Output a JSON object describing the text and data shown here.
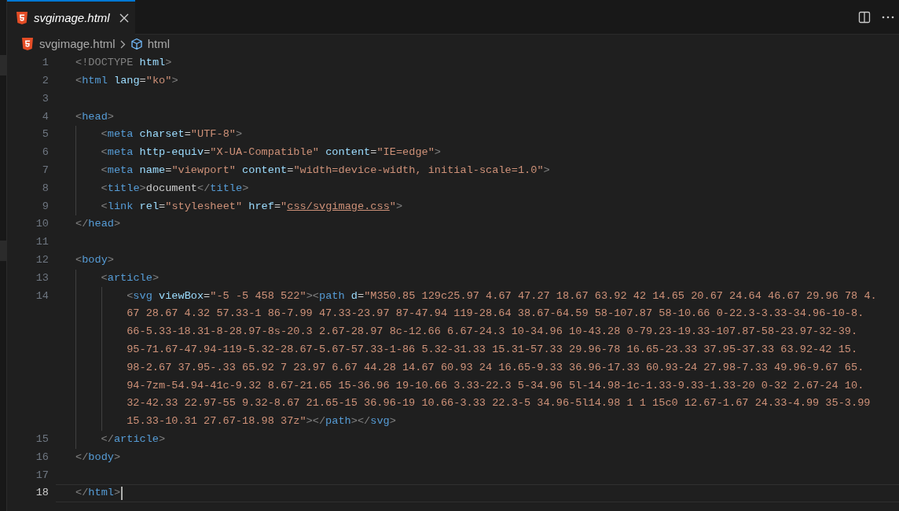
{
  "tab": {
    "title": "svgimage.html",
    "selected": true
  },
  "breadcrumb": {
    "file": "svgimage.html",
    "symbol": "html"
  },
  "lines": [
    {
      "number": "1",
      "current": false,
      "tokens": [
        {
          "kind": "punct",
          "text": "<!DOCTYPE"
        },
        {
          "kind": "attr",
          "text": " html"
        },
        {
          "kind": "punct",
          "text": ">"
        }
      ]
    },
    {
      "number": "2",
      "current": false,
      "tokens": [
        {
          "kind": "punct",
          "text": "<"
        },
        {
          "kind": "tag",
          "text": "html"
        },
        {
          "kind": "attr",
          "text": " lang"
        },
        {
          "kind": "plain",
          "text": "="
        },
        {
          "kind": "str",
          "text": "\"ko\""
        },
        {
          "kind": "punct",
          "text": ">"
        }
      ]
    },
    {
      "number": "3",
      "current": false
    },
    {
      "number": "4",
      "current": false,
      "tokens": [
        {
          "kind": "punct",
          "text": "<"
        },
        {
          "kind": "tag",
          "text": "head"
        },
        {
          "kind": "punct",
          "text": ">"
        }
      ],
      "children": [
        {
          "number": "5",
          "current": false,
          "tokens": [
            {
              "kind": "punct",
              "text": "<"
            },
            {
              "kind": "tag",
              "text": "meta"
            },
            {
              "kind": "attr",
              "text": " charset"
            },
            {
              "kind": "plain",
              "text": "="
            },
            {
              "kind": "str",
              "text": "\"UTF-8\""
            },
            {
              "kind": "punct",
              "text": ">"
            }
          ]
        },
        {
          "number": "6",
          "current": false,
          "tokens": [
            {
              "kind": "punct",
              "text": "<"
            },
            {
              "kind": "tag",
              "text": "meta"
            },
            {
              "kind": "attr",
              "text": " http-equiv"
            },
            {
              "kind": "plain",
              "text": "="
            },
            {
              "kind": "str",
              "text": "\"X-UA-Compatible\""
            },
            {
              "kind": "attr",
              "text": " content"
            },
            {
              "kind": "plain",
              "text": "="
            },
            {
              "kind": "str",
              "text": "\"IE=edge\""
            },
            {
              "kind": "punct",
              "text": ">"
            }
          ]
        },
        {
          "number": "7",
          "current": false,
          "tokens": [
            {
              "kind": "punct",
              "text": "<"
            },
            {
              "kind": "tag",
              "text": "meta"
            },
            {
              "kind": "attr",
              "text": " name"
            },
            {
              "kind": "plain",
              "text": "="
            },
            {
              "kind": "str",
              "text": "\"viewport\""
            },
            {
              "kind": "attr",
              "text": " content"
            },
            {
              "kind": "plain",
              "text": "="
            },
            {
              "kind": "str",
              "text": "\"width=device-width, initial-scale=1.0\""
            },
            {
              "kind": "punct",
              "text": ">"
            }
          ]
        },
        {
          "number": "8",
          "current": false,
          "tokens": [
            {
              "kind": "punct",
              "text": "<"
            },
            {
              "kind": "tag",
              "text": "title"
            },
            {
              "kind": "punct",
              "text": ">"
            },
            {
              "kind": "plain",
              "text": "document"
            },
            {
              "kind": "punct",
              "text": "</"
            },
            {
              "kind": "tag",
              "text": "title"
            },
            {
              "kind": "punct",
              "text": ">"
            }
          ]
        },
        {
          "number": "9",
          "current": false,
          "tokens": [
            {
              "kind": "punct",
              "text": "<"
            },
            {
              "kind": "tag",
              "text": "link"
            },
            {
              "kind": "attr",
              "text": " rel"
            },
            {
              "kind": "plain",
              "text": "="
            },
            {
              "kind": "str",
              "text": "\"stylesheet\""
            },
            {
              "kind": "attr",
              "text": " href"
            },
            {
              "kind": "plain",
              "text": "="
            },
            {
              "kind": "str",
              "text": "\""
            },
            {
              "kind": "link",
              "text": "css/svgimage.css"
            },
            {
              "kind": "str",
              "text": "\""
            },
            {
              "kind": "punct",
              "text": ">"
            }
          ]
        }
      ]
    },
    {
      "number": "10",
      "current": false,
      "tokens": [
        {
          "kind": "punct",
          "text": "</"
        },
        {
          "kind": "tag",
          "text": "head"
        },
        {
          "kind": "punct",
          "text": ">"
        }
      ]
    },
    {
      "number": "11",
      "current": false
    },
    {
      "number": "12",
      "current": false,
      "tokens": [
        {
          "kind": "punct",
          "text": "<"
        },
        {
          "kind": "tag",
          "text": "body"
        },
        {
          "kind": "punct",
          "text": ">"
        }
      ],
      "children": [
        {
          "number": "13",
          "current": false,
          "tokens": [
            {
              "kind": "punct",
              "text": "<"
            },
            {
              "kind": "tag",
              "text": "article"
            },
            {
              "kind": "punct",
              "text": ">"
            }
          ],
          "children": [
            {
              "number": "14",
              "current": false,
              "tokens": [
                {
                  "kind": "punct",
                  "text": "<"
                },
                {
                  "kind": "tag",
                  "text": "svg"
                },
                {
                  "kind": "attr",
                  "text": " viewBox"
                },
                {
                  "kind": "plain",
                  "text": "="
                },
                {
                  "kind": "str",
                  "text": "\"-5 -5 458 522\""
                },
                {
                  "kind": "punct",
                  "text": "><"
                },
                {
                  "kind": "tag",
                  "text": "path"
                },
                {
                  "kind": "attr",
                  "text": " d"
                },
                {
                  "kind": "plain",
                  "text": "="
                },
                {
                  "kind": "str",
                  "text": "\"M350.85 129c25.97 4.67 47.27 18.67 63.92 42 14.65 20.67 24.64 46.67 29.96 78 4."
                }
              ],
              "continuations": [
                {
                  "tokens": [
                    {
                      "kind": "str",
                      "text": "67 28.67 4.32 57.33-1 86-7.99 47.33-23.97 87-47.94 119-28.64 38.67-64.59 58-107.87 58-10.66 0-22.3-3.33-34.96-10-8."
                    }
                  ]
                },
                {
                  "tokens": [
                    {
                      "kind": "str",
                      "text": "66-5.33-18.31-8-28.97-8s-20.3 2.67-28.97 8c-12.66 6.67-24.3 10-34.96 10-43.28 0-79.23-19.33-107.87-58-23.97-32-39."
                    }
                  ]
                },
                {
                  "tokens": [
                    {
                      "kind": "str",
                      "text": "95-71.67-47.94-119-5.32-28.67-5.67-57.33-1-86 5.32-31.33 15.31-57.33 29.96-78 16.65-23.33 37.95-37.33 63.92-42 15."
                    }
                  ]
                },
                {
                  "tokens": [
                    {
                      "kind": "str",
                      "text": "98-2.67 37.95-.33 65.92 7 23.97 6.67 44.28 14.67 60.93 24 16.65-9.33 36.96-17.33 60.93-24 27.98-7.33 49.96-9.67 65."
                    }
                  ]
                },
                {
                  "tokens": [
                    {
                      "kind": "str",
                      "text": "94-7zm-54.94-41c-9.32 8.67-21.65 15-36.96 19-10.66 3.33-22.3 5-34.96 5l-14.98-1c-1.33-9.33-1.33-20 0-32 2.67-24 10."
                    }
                  ]
                },
                {
                  "tokens": [
                    {
                      "kind": "str",
                      "text": "32-42.33 22.97-55 9.32-8.67 21.65-15 36.96-19 10.66-3.33 22.3-5 34.96-5l14.98 1 1 15c0 12.67-1.67 24.33-4.99 35-3.99"
                    }
                  ]
                },
                {
                  "tokens": [
                    {
                      "kind": "str",
                      "text": "15.33-10.31 27.67-18.98 37z\""
                    },
                    {
                      "kind": "punct",
                      "text": "></"
                    },
                    {
                      "kind": "tag",
                      "text": "path"
                    },
                    {
                      "kind": "punct",
                      "text": "></"
                    },
                    {
                      "kind": "tag",
                      "text": "svg"
                    },
                    {
                      "kind": "punct",
                      "text": ">"
                    }
                  ]
                }
              ]
            }
          ]
        },
        {
          "number": "15",
          "current": false,
          "tokens": [
            {
              "kind": "punct",
              "text": "</"
            },
            {
              "kind": "tag",
              "text": "article"
            },
            {
              "kind": "punct",
              "text": ">"
            }
          ]
        }
      ]
    },
    {
      "number": "16",
      "current": false,
      "tokens": [
        {
          "kind": "punct",
          "text": "</"
        },
        {
          "kind": "tag",
          "text": "body"
        },
        {
          "kind": "punct",
          "text": ">"
        }
      ]
    },
    {
      "number": "17",
      "current": false
    },
    {
      "number": "18",
      "current": true,
      "tokens": [
        {
          "kind": "punct",
          "text": "</"
        },
        {
          "kind": "tag",
          "text": "html"
        },
        {
          "kind": "punct",
          "text": ">"
        }
      ]
    }
  ]
}
